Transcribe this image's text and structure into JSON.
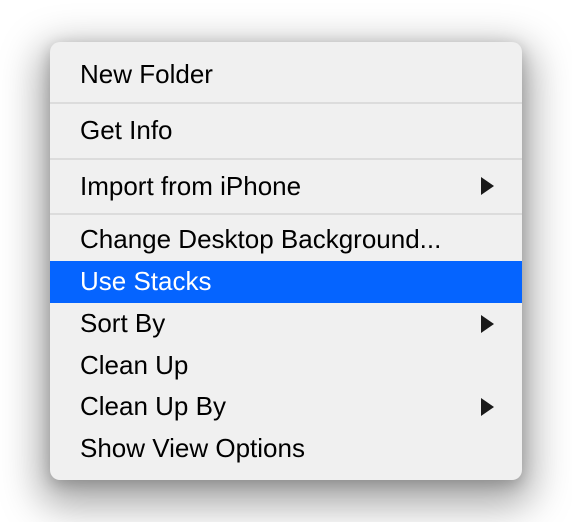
{
  "menu": {
    "items": [
      {
        "label": "New Folder"
      },
      {
        "label": "Get Info"
      },
      {
        "label": "Import from iPhone"
      },
      {
        "label": "Change Desktop Background..."
      },
      {
        "label": "Use Stacks"
      },
      {
        "label": "Sort By"
      },
      {
        "label": "Clean Up"
      },
      {
        "label": "Clean Up By"
      },
      {
        "label": "Show View Options"
      }
    ]
  }
}
